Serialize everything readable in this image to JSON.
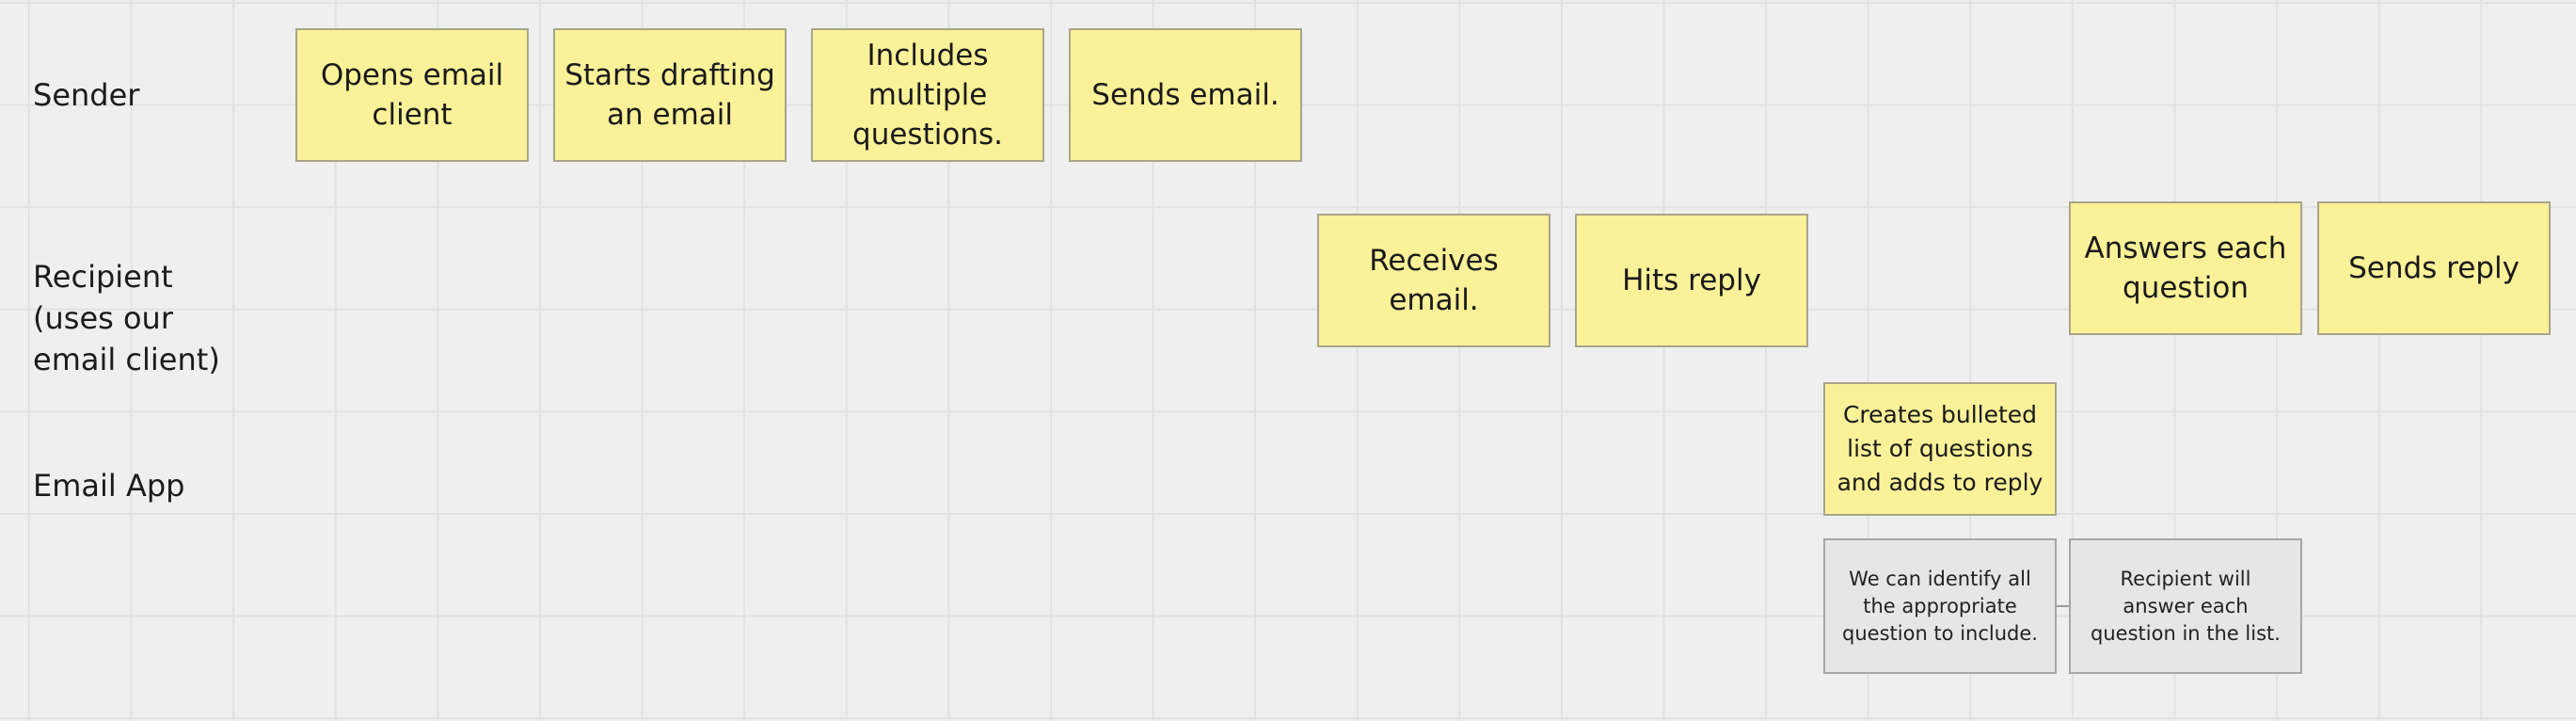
{
  "lanes": {
    "sender": "Sender",
    "recipient": "Recipient\n(uses our\nemail client)",
    "email_app": "Email App"
  },
  "sender_steps": [
    "Opens email client",
    "Starts drafting an email",
    "Includes multiple questions.",
    "Sends email."
  ],
  "recipient_steps": [
    "Receives email.",
    "Hits reply",
    "Answers each question",
    "Sends reply"
  ],
  "email_app_steps": [
    "Creates bulleted list of questions and adds to reply"
  ],
  "notes": [
    "We can identify all the appropriate question to include.",
    "Recipient will answer each question in the list."
  ],
  "colors": {
    "sticky": "#fbf198",
    "note": "#e6e6e6",
    "canvas": "#efefef"
  }
}
